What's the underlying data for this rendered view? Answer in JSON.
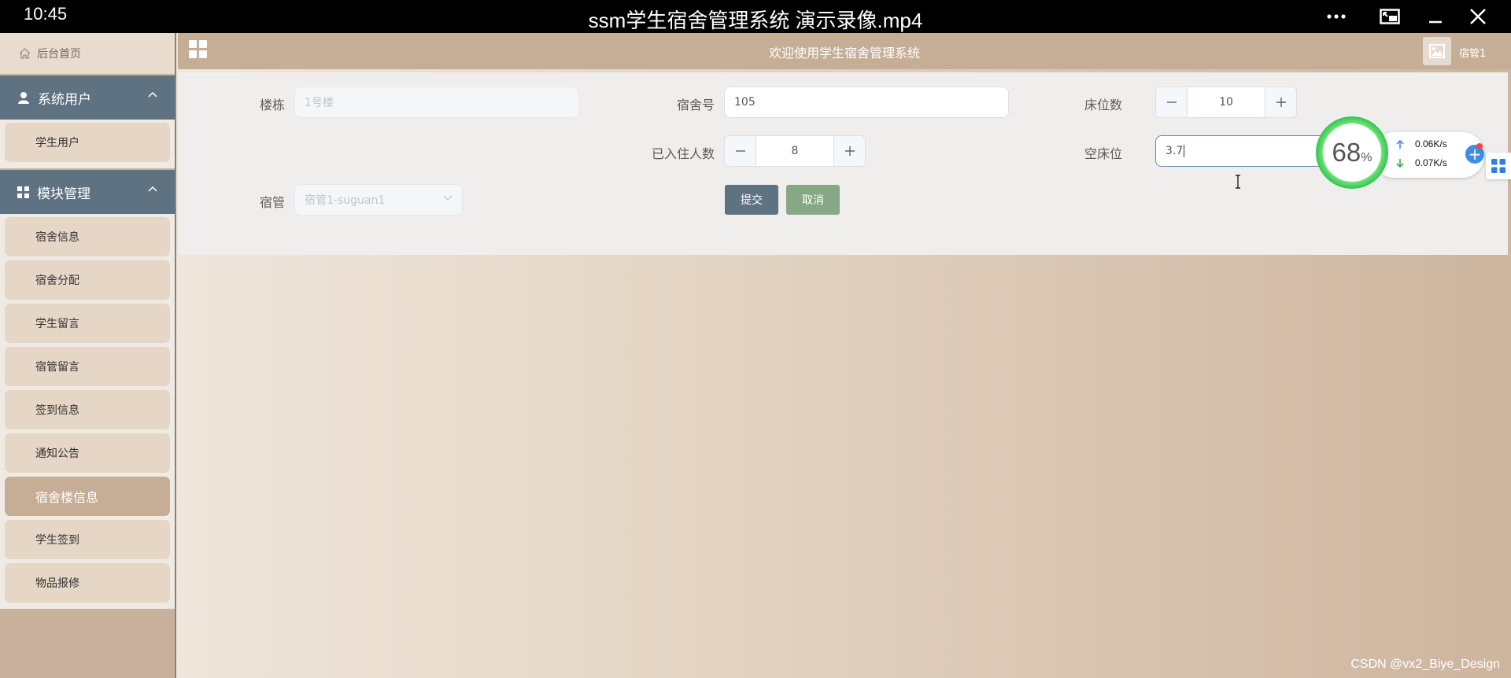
{
  "player": {
    "time": "10:45",
    "title": "ssm学生宿舍管理系统 演示录像.mp4"
  },
  "sidebar": {
    "home_label": "后台首页",
    "groups": [
      {
        "label": "系统用户",
        "items": [
          "学生用户"
        ]
      },
      {
        "label": "模块管理",
        "items": [
          "宿舍信息",
          "宿舍分配",
          "学生留言",
          "宿管留言",
          "签到信息",
          "通知公告",
          "宿舍楼信息",
          "学生签到",
          "物品报修"
        ]
      }
    ],
    "active_item": "宿舍楼信息"
  },
  "topbar": {
    "title": "欢迎使用学生宿舍管理系统",
    "username": "宿管1"
  },
  "form": {
    "building": {
      "label": "楼栋",
      "value": "1号楼"
    },
    "room_no": {
      "label": "宿舍号",
      "value": "105"
    },
    "beds": {
      "label": "床位数",
      "value": "10"
    },
    "occupied": {
      "label": "已入住人数",
      "value": "8"
    },
    "empty_beds": {
      "label": "空床位",
      "value": "3.7"
    },
    "manager": {
      "label": "宿管",
      "value": "宿管1-suguan1"
    },
    "submit_label": "提交",
    "cancel_label": "取消"
  },
  "net_widget": {
    "percent": "68",
    "percent_suffix": "%",
    "upload": "0.06K/s",
    "download": "0.07K/s"
  },
  "watermark": "CSDN @vx2_Biye_Design",
  "colors": {
    "sidebar_group": "#5e7281",
    "sidebar_active": "#c6ad95",
    "submit": "#5e7281",
    "cancel": "#86a884"
  }
}
